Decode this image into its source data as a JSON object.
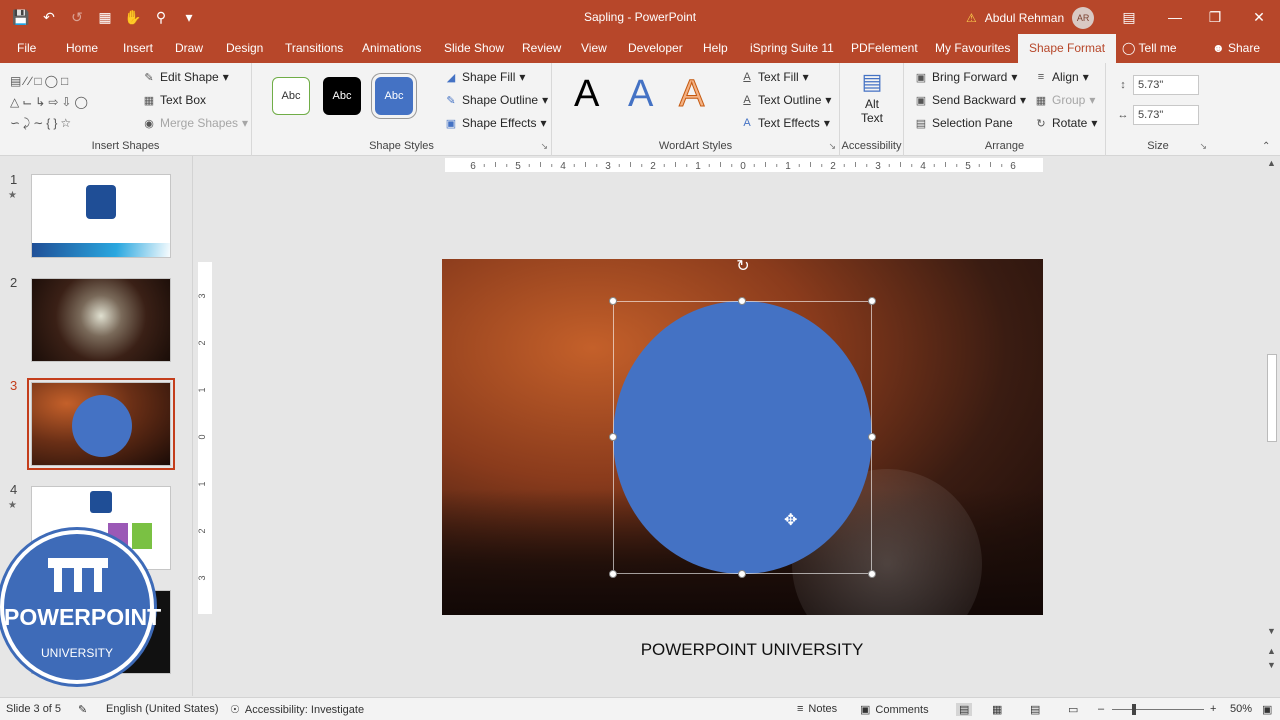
{
  "window": {
    "title": "Sapling  -  PowerPoint",
    "user_name": "Abdul Rehman",
    "user_initials": "AR"
  },
  "tabs": [
    "File",
    "Home",
    "Insert",
    "Draw",
    "Design",
    "Transitions",
    "Animations",
    "Slide Show",
    "Review",
    "View",
    "Developer",
    "Help",
    "iSpring Suite 11",
    "PDFelement",
    "My Favourites",
    "Shape Format",
    "Tell me",
    "Share"
  ],
  "ribbon": {
    "insert_shapes": {
      "label": "Insert Shapes",
      "edit_shape": "Edit Shape",
      "text_box": "Text Box",
      "merge_shapes": "Merge Shapes"
    },
    "shape_styles": {
      "label": "Shape Styles",
      "swatches": [
        "Abc",
        "Abc",
        "Abc"
      ],
      "shape_fill": "Shape Fill",
      "shape_outline": "Shape Outline",
      "shape_effects": "Shape Effects"
    },
    "wordart": {
      "label": "WordArt Styles",
      "letters": [
        "A",
        "A",
        "A"
      ],
      "text_fill": "Text Fill",
      "text_outline": "Text Outline",
      "text_effects": "Text Effects"
    },
    "accessibility": {
      "label": "Accessibility",
      "alt_text": "Alt Text"
    },
    "arrange": {
      "label": "Arrange",
      "bring_forward": "Bring Forward",
      "send_backward": "Send Backward",
      "selection_pane": "Selection Pane",
      "align": "Align",
      "group": "Group",
      "rotate": "Rotate"
    },
    "size": {
      "label": "Size",
      "height": "5.73\"",
      "width": "5.73\""
    }
  },
  "slides": [
    {
      "num": "1",
      "star": "★"
    },
    {
      "num": "2",
      "star": ""
    },
    {
      "num": "3",
      "star": ""
    },
    {
      "num": "4",
      "star": "★"
    }
  ],
  "ruler": {
    "h_ticks": [
      "6",
      "5",
      "4",
      "3",
      "2",
      "1",
      "0",
      "1",
      "2",
      "3",
      "4",
      "5",
      "6"
    ],
    "v_ticks": [
      "3",
      "2",
      "1",
      "0",
      "1",
      "2",
      "3"
    ]
  },
  "notes_text": "POWERPOINT UNIVERSITY",
  "badge": {
    "line1": "POWERPOINT",
    "line2": "UNIVERSITY"
  },
  "status": {
    "slide": "Slide 3 of 5",
    "language": "English (United States)",
    "accessibility": "Accessibility: Investigate",
    "notes": "Notes",
    "comments": "Comments",
    "zoom": "50%"
  },
  "colors": {
    "accent": "#b7472a",
    "shape_fill": "#4472c4"
  }
}
